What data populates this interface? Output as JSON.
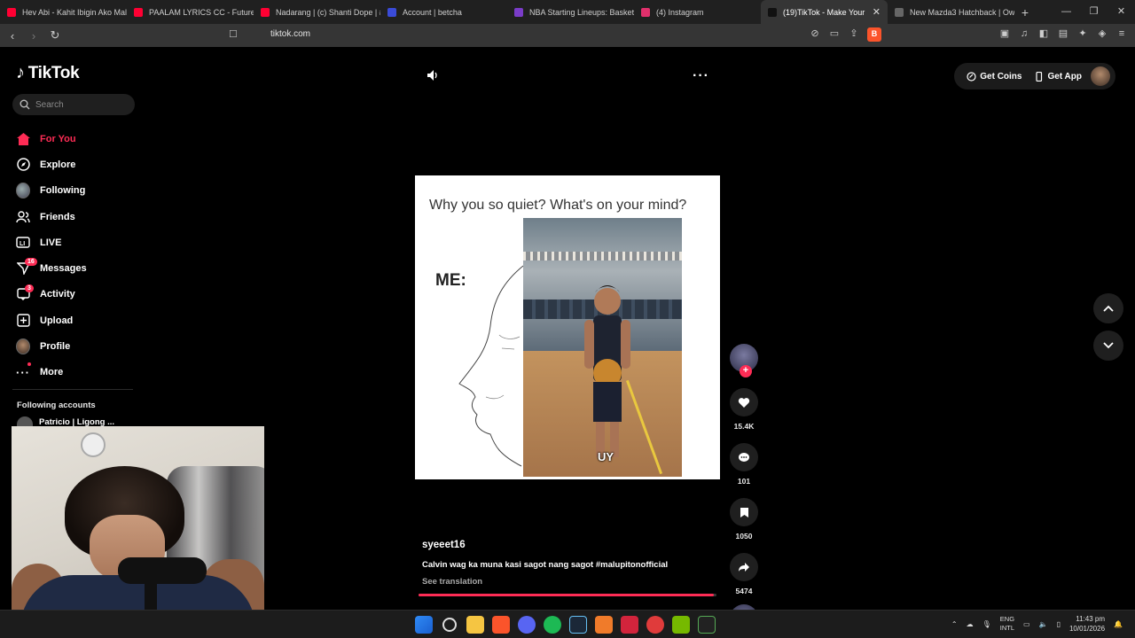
{
  "browser": {
    "tabs": [
      {
        "label": "Hev Abi - Kahit Ibigin Ako Mali",
        "color": "#ff0033"
      },
      {
        "label": "PAALAM LYRICS CC - Future Th",
        "color": "#ff0033"
      },
      {
        "label": "Nadarang | (c) Shanti Dope | #",
        "color": "#ff0033"
      },
      {
        "label": "Account | betcha",
        "color": "#3a4bd8"
      },
      {
        "label": "NBA Starting Lineups: Basketb",
        "color": "#7a3cc8"
      },
      {
        "label": "(4) Instagram",
        "color": "#e1306c"
      },
      {
        "label": "(19)TikTok - Make Your",
        "color": "#111111",
        "active": true
      },
      {
        "label": "New Mazda3 Hatchback | Own",
        "color": "#666666"
      }
    ],
    "url": "tiktok.com"
  },
  "tiktok": {
    "logo": "TikTok",
    "search_placeholder": "Search",
    "nav": [
      {
        "label": "For You",
        "icon": "home-icon",
        "active": true
      },
      {
        "label": "Explore",
        "icon": "compass-icon"
      },
      {
        "label": "Following",
        "icon": "following-avatar"
      },
      {
        "label": "Friends",
        "icon": "friends-icon"
      },
      {
        "label": "LIVE",
        "icon": "live-icon"
      },
      {
        "label": "Messages",
        "icon": "messages-icon",
        "badge": "16"
      },
      {
        "label": "Activity",
        "icon": "activity-icon",
        "badge": "3"
      },
      {
        "label": "Upload",
        "icon": "upload-icon"
      },
      {
        "label": "Profile",
        "icon": "profile-avatar"
      },
      {
        "label": "More",
        "icon": "more-icon"
      }
    ],
    "following_accounts_title": "Following accounts",
    "following_accounts": [
      {
        "name": "Patricio | Ligong ..."
      }
    ],
    "top_right": {
      "coins": "Get Coins",
      "app": "Get App"
    },
    "video": {
      "caption": "Why you so quiet? What's on your mind?",
      "me_label": "ME:",
      "subtitle": "UY",
      "author": "syeeet16",
      "description": "Calvin wag ka muna kasi sagot nang sagot #malupitonofficial",
      "see_translation": "See translation",
      "progress": 0.99
    },
    "actions": {
      "likes": "15.4K",
      "comments": "101",
      "saves": "1050",
      "shares": "5474"
    }
  },
  "taskbar": {
    "lang_top": "ENG",
    "lang_bottom": "INTL",
    "time": "11:43 pm",
    "date": "10/01/2026"
  }
}
